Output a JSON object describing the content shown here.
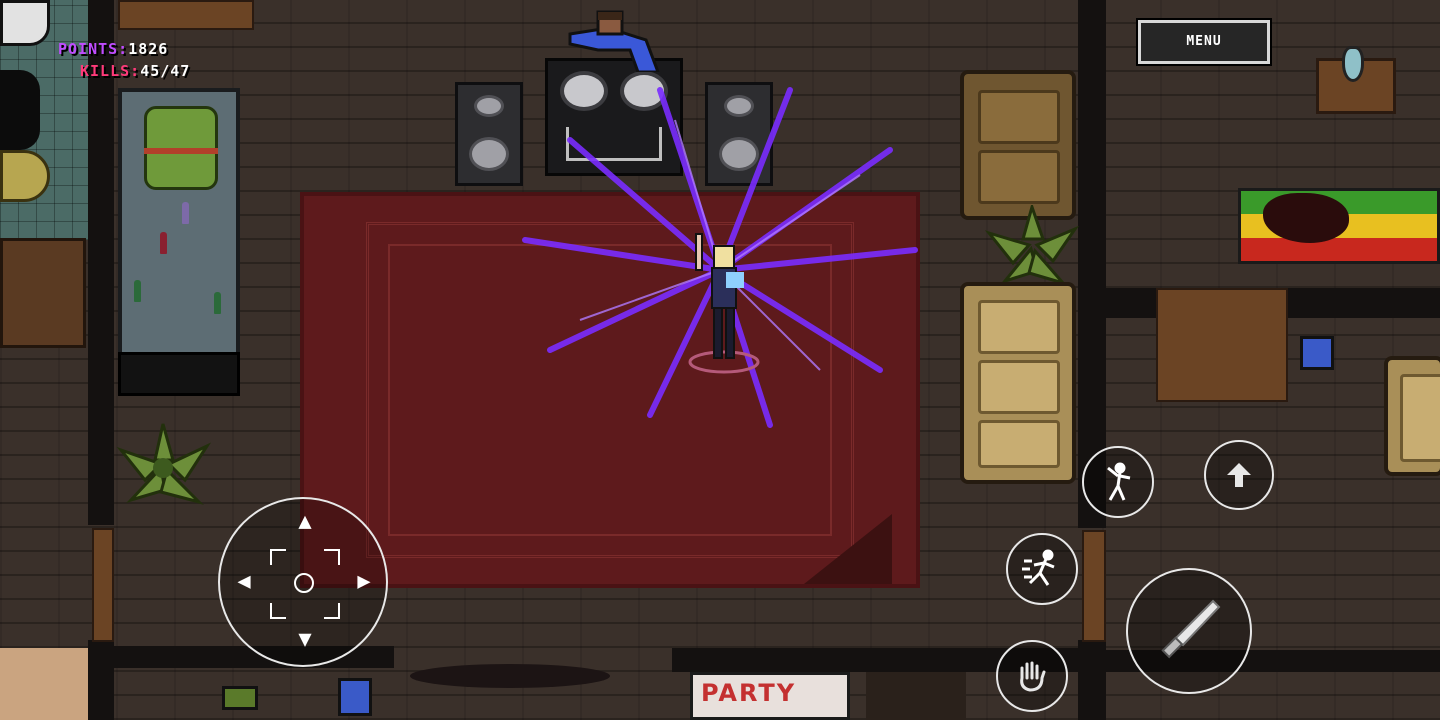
{
  "hud": {
    "points_label": "POINTS:",
    "points_value": "1826",
    "kills_label": "KILLS:",
    "kills_value": "45/47"
  },
  "menu": {
    "label": "MENU"
  },
  "poster": {
    "text": "PARTY"
  },
  "controls": {
    "dpad": "movement-dpad",
    "buttons": [
      "dance-button",
      "use-up-button",
      "sprint-button",
      "knife-attack-button",
      "grab-button"
    ]
  },
  "colors": {
    "points_label": "#c04cff",
    "kills_label": "#ff3a7a",
    "ability_burst": "#7a2cff",
    "rug": "#5e1a1c"
  }
}
